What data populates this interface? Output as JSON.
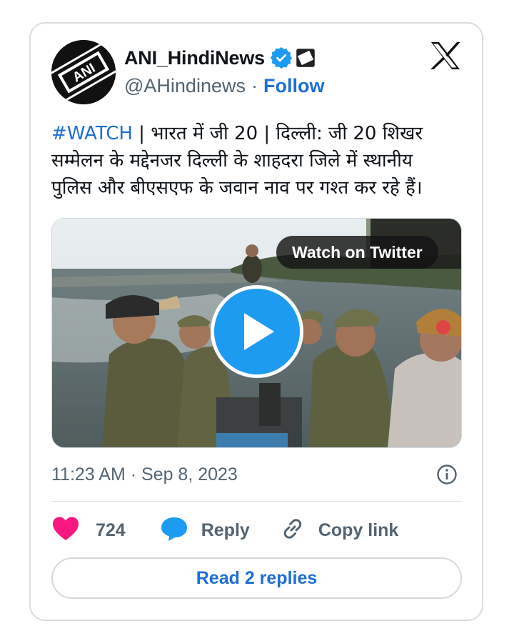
{
  "author": {
    "display_name": "ANI_HindiNews",
    "handle": "@AHindinews",
    "separator": "·",
    "follow_label": "Follow",
    "avatar_icon": "ani-logo-icon",
    "verified_icon": "verified-badge-icon",
    "affiliate_icon": "ani-affiliate-badge-icon"
  },
  "tweet": {
    "hashtag": "#WATCH",
    "body": " | भारत में जी 20 | दिल्ली: जी 20 शिखर सम्मेलन के मद्देनजर दिल्ली के शाहदरा जिले में स्थानीय पुलिस और बीएसएफ के जवान नाव पर गश्त कर रहे हैं।"
  },
  "media": {
    "watch_label": "Watch on Twitter",
    "play_icon": "play-icon"
  },
  "meta": {
    "timestamp": "11:23 AM · Sep 8, 2023",
    "info_icon": "info-icon"
  },
  "actions": {
    "like_count": "724",
    "reply_label": "Reply",
    "copy_link_label": "Copy link"
  },
  "footer": {
    "read_replies_label": "Read 2 replies"
  },
  "colors": {
    "link_blue": "#1d6fd6",
    "play_blue": "#1d9bf0",
    "heart_pink": "#f91880",
    "muted_text": "#536471"
  }
}
